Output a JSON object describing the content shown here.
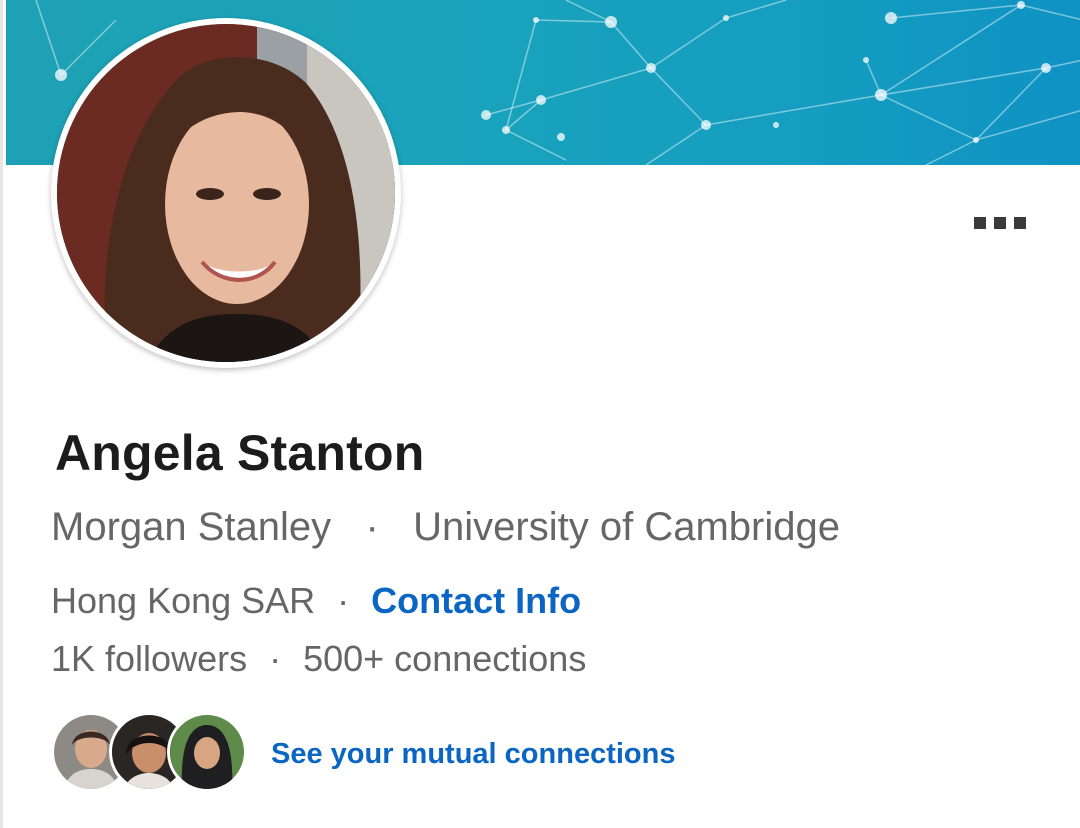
{
  "profile": {
    "name": "Angela Stanton",
    "company": "Morgan Stanley",
    "school": "University of Cambridge",
    "location": "Hong Kong SAR",
    "contact_info_label": "Contact Info",
    "followers": "1K followers",
    "connections": "500+ connections",
    "separator": "·"
  },
  "mutual": {
    "link_label": "See your mutual connections"
  },
  "colors": {
    "link_blue": "#0a66c2",
    "banner_teal": "#1aa3bb",
    "name_text": "#1c1c1c",
    "secondary_text": "#666666"
  },
  "icons": {
    "more": "more-horizontal-icon"
  }
}
